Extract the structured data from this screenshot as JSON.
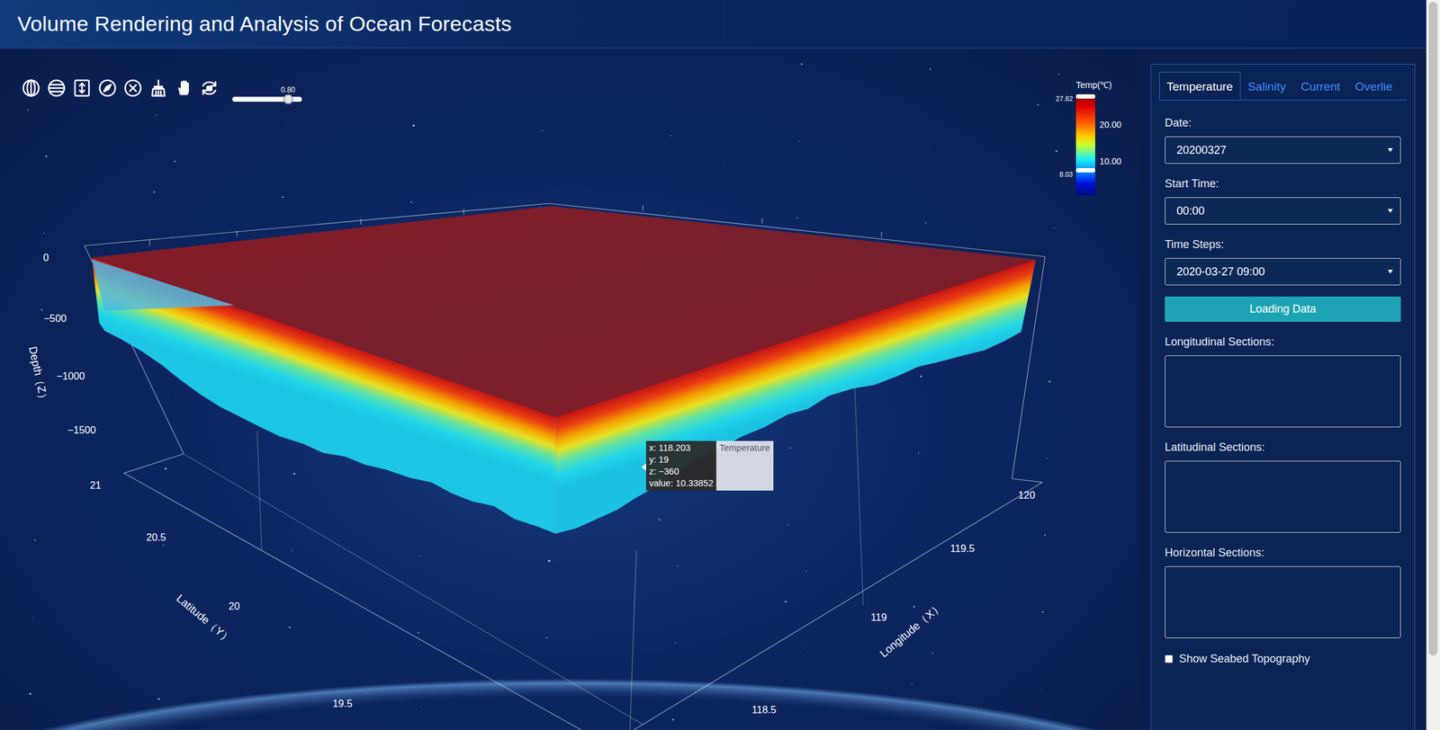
{
  "window": {
    "title": "Volume Rendering and Analysis of Ocean Forecasts"
  },
  "opacity_slider": {
    "reading": "0.80",
    "level": 0.8
  },
  "colorbar": {
    "title": "Temp(℃)",
    "handles": [
      {
        "reading": "27.82",
        "level": 1.0
      },
      {
        "reading": "8.03",
        "level": 0.25
      }
    ],
    "ticks": [
      {
        "label": "20.00",
        "level": 0.7
      },
      {
        "label": "10.00",
        "level": 0.34
      }
    ]
  },
  "chart": {
    "axes": {
      "z": {
        "title": "Depth（Z）",
        "ticks": [
          "0",
          "−500",
          "−1000",
          "−1500"
        ]
      },
      "y": {
        "title": "Latitude（Y）",
        "ticks": [
          "21",
          "20.5",
          "20",
          "19.5"
        ]
      },
      "x": {
        "title": "Longitude（X）",
        "ticks": [
          "120",
          "119.5",
          "119",
          "118.5"
        ]
      }
    }
  },
  "tooltip": {
    "lines": [
      "x: 118.203",
      "y: 19",
      "z: −360",
      "value: 10.33852"
    ],
    "series": "Temperature"
  },
  "panel": {
    "tabs": [
      {
        "label": "Temperature",
        "selected": true
      },
      {
        "label": "Salinity",
        "selected": false
      },
      {
        "label": "Current",
        "selected": false
      },
      {
        "label": "Overlie",
        "selected": false
      }
    ],
    "fields": [
      {
        "kind": "select",
        "label": "Date:",
        "value": "20200327"
      },
      {
        "kind": "select",
        "label": "Start Time:",
        "value": "00:00"
      },
      {
        "kind": "select",
        "label": "Time Steps:",
        "value": "2020-03-27 09:00"
      },
      {
        "kind": "button",
        "label": "Loading Data"
      },
      {
        "kind": "textarea",
        "label": "Longitudinal Sections:",
        "value": ""
      },
      {
        "kind": "textarea",
        "label": "Latitudinal Sections:",
        "value": ""
      },
      {
        "kind": "textarea",
        "label": "Horizontal Sections:",
        "value": ""
      },
      {
        "kind": "checkbox",
        "label": "Show Seabed Topography",
        "checked": false
      }
    ]
  },
  "scrollbar": {
    "level": 0.9
  }
}
